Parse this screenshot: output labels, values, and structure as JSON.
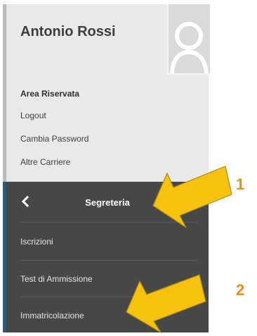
{
  "user": {
    "name": "Antonio Rossi",
    "avatar_icon": "user-silhouette-icon"
  },
  "account": {
    "heading": "Area Riservata",
    "links": [
      {
        "label": "Logout"
      },
      {
        "label": "Cambia Password"
      },
      {
        "label": "Altre Carriere"
      }
    ]
  },
  "menu": {
    "back_icon": "chevron-left-icon",
    "title": "Segreteria",
    "items": [
      {
        "label": "Iscrizioni"
      },
      {
        "label": "Test di Ammissione"
      },
      {
        "label": "Immatricolazione"
      }
    ]
  },
  "annotations": {
    "step1": "1",
    "step2": "2",
    "arrow_color": "#f7c20e",
    "number_color": "#f08a1e"
  },
  "colors": {
    "user_panel_bg": "#e9e9e9",
    "menu_bg": "#474747",
    "accent_edge": "#2f5a79"
  }
}
